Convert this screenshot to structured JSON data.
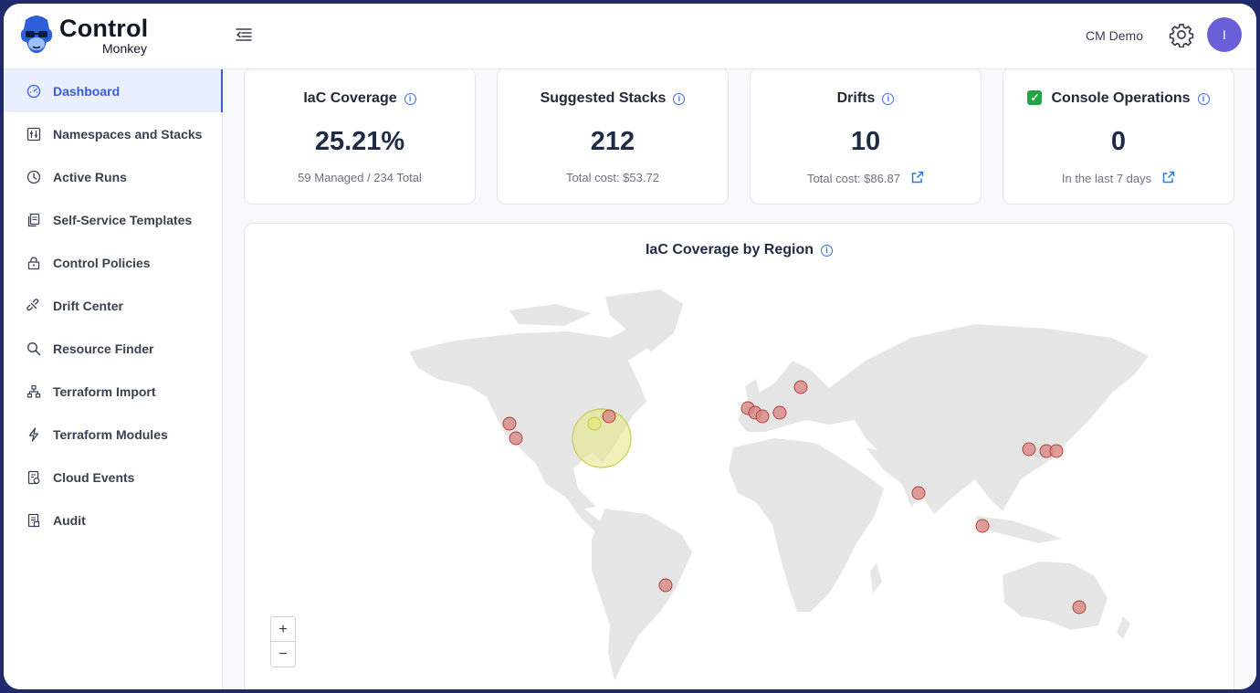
{
  "brand": {
    "word1": "Control",
    "word2": "Monkey"
  },
  "header": {
    "user_name": "CM Demo",
    "avatar_initial": "I"
  },
  "sidebar": {
    "items": [
      {
        "label": "Dashboard",
        "icon": "gauge-icon",
        "active": true
      },
      {
        "label": "Namespaces and Stacks",
        "icon": "sliders-icon"
      },
      {
        "label": "Active Runs",
        "icon": "clock-icon"
      },
      {
        "label": "Self-Service Templates",
        "icon": "copy-document-icon"
      },
      {
        "label": "Control Policies",
        "icon": "lock-icon"
      },
      {
        "label": "Drift Center",
        "icon": "broken-link-icon"
      },
      {
        "label": "Resource Finder",
        "icon": "search-icon"
      },
      {
        "label": "Terraform Import",
        "icon": "hierarchy-icon"
      },
      {
        "label": "Terraform Modules",
        "icon": "lightning-icon"
      },
      {
        "label": "Cloud Events",
        "icon": "event-document-icon"
      },
      {
        "label": "Audit",
        "icon": "audit-document-icon"
      }
    ]
  },
  "cards": [
    {
      "title": "IaC Coverage",
      "value": "25.21%",
      "sub": "59 Managed / 234 Total"
    },
    {
      "title": "Suggested Stacks",
      "value": "212",
      "sub": "Total cost: $53.72"
    },
    {
      "title": "Drifts",
      "value": "10",
      "sub": "Total cost: $86.87"
    },
    {
      "title": "Console Operations",
      "value": "0",
      "sub": "In the last 7 days"
    }
  ],
  "map": {
    "title": "IaC Coverage by Region",
    "zoom_in": "+",
    "zoom_out": "−",
    "colors": {
      "land": "#e6e6e6",
      "marker": "#d88a86",
      "marker_stroke": "#b5403a",
      "highlight": "#e6e88a",
      "highlight_stroke": "#c8cc4a"
    }
  }
}
